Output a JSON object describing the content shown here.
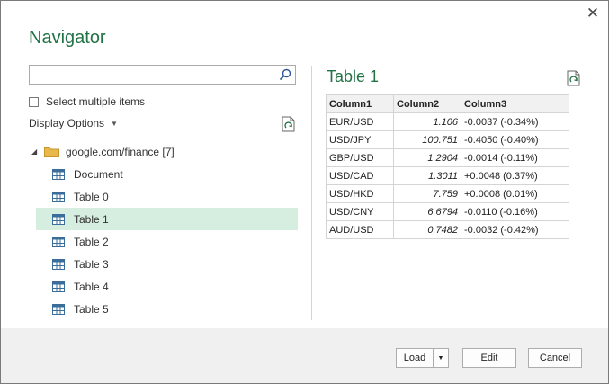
{
  "dialog": {
    "title": "Navigator",
    "close_symbol": "✕"
  },
  "left": {
    "search": {
      "value": "",
      "placeholder": ""
    },
    "select_multiple_label": "Select multiple items",
    "display_options_label": "Display Options",
    "tree": {
      "root_label": "google.com/finance [7]",
      "items": [
        {
          "label": "Document",
          "selected": false
        },
        {
          "label": "Table 0",
          "selected": false
        },
        {
          "label": "Table 1",
          "selected": true
        },
        {
          "label": "Table 2",
          "selected": false
        },
        {
          "label": "Table 3",
          "selected": false
        },
        {
          "label": "Table 4",
          "selected": false
        },
        {
          "label": "Table 5",
          "selected": false
        }
      ]
    }
  },
  "preview": {
    "title": "Table 1",
    "columns": [
      "Column1",
      "Column2",
      "Column3"
    ],
    "rows": [
      [
        "EUR/USD",
        "1.106",
        "-0.0037 (-0.34%)"
      ],
      [
        "USD/JPY",
        "100.751",
        "-0.4050 (-0.40%)"
      ],
      [
        "GBP/USD",
        "1.2904",
        "-0.0014 (-0.11%)"
      ],
      [
        "USD/CAD",
        "1.3011",
        "+0.0048 (0.37%)"
      ],
      [
        "USD/HKD",
        "7.759",
        "+0.0008 (0.01%)"
      ],
      [
        "USD/CNY",
        "6.6794",
        "-0.0110 (-0.16%)"
      ],
      [
        "AUD/USD",
        "0.7482",
        "-0.0032 (-0.42%)"
      ]
    ]
  },
  "footer": {
    "load_label": "Load",
    "edit_label": "Edit",
    "cancel_label": "Cancel"
  },
  "colors": {
    "accent_green": "#217346",
    "selection_bg": "#d6eedf",
    "footer_bg": "#f0f0f0"
  },
  "icons": [
    "close-icon",
    "search-icon",
    "checkbox",
    "dropdown-caret-icon",
    "refresh-icon",
    "expand-arrow-icon",
    "folder-icon",
    "table-icon"
  ]
}
